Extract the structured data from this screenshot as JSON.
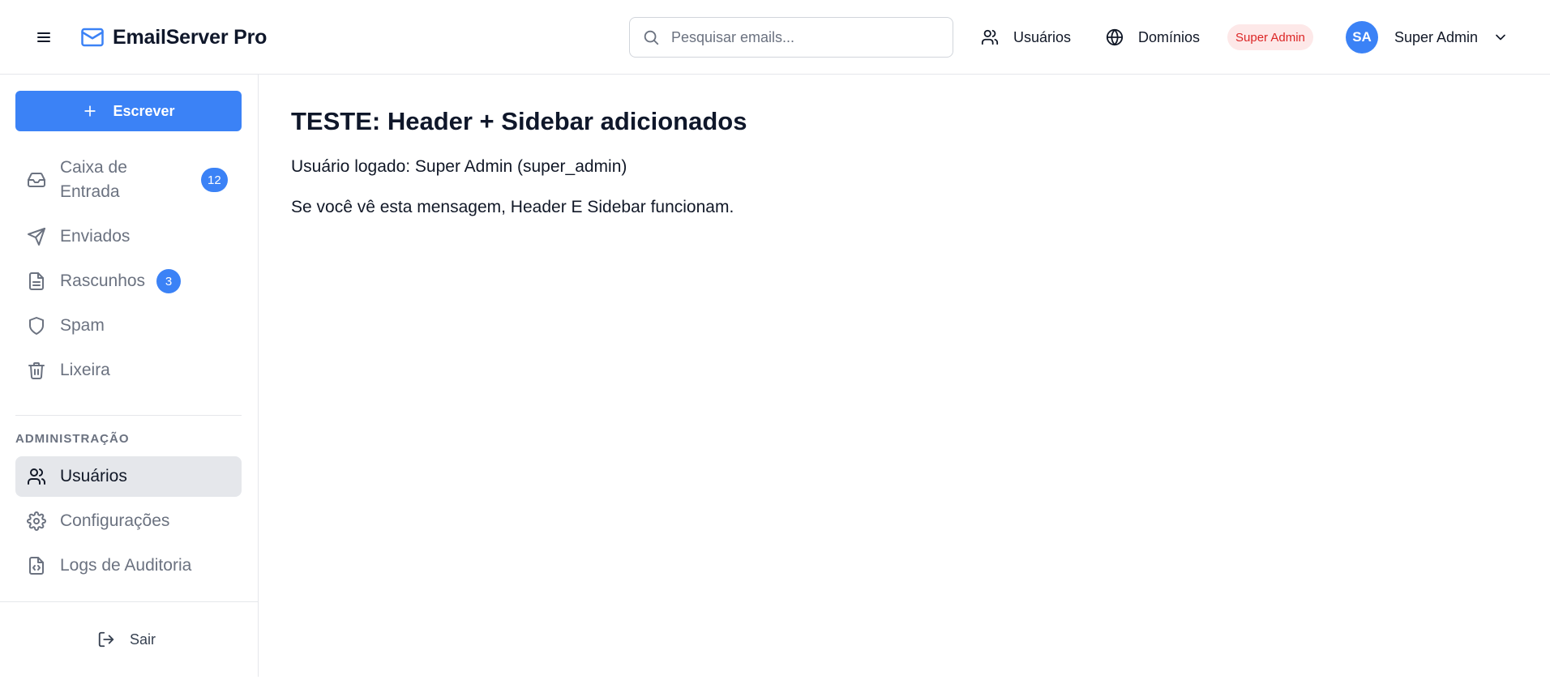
{
  "app": {
    "name": "EmailServer Pro"
  },
  "colors": {
    "accent": "#3b82f6",
    "danger": "#dc2626",
    "danger_bg": "#fde8e8",
    "muted": "#6b7280",
    "active_bg": "#e5e7eb"
  },
  "header": {
    "menu_icon": "hamburger-menu-icon",
    "brand_icon": "mail-icon",
    "search": {
      "placeholder": "Pesquisar emails...",
      "value": "",
      "icon": "search-icon"
    },
    "nav": [
      {
        "label": "Usuários",
        "icon": "users-icon"
      },
      {
        "label": "Domínios",
        "icon": "globe-icon"
      }
    ],
    "role_badge": "Super Admin",
    "user": {
      "initials": "SA",
      "name": "Super Admin",
      "chevron_icon": "chevron-down-icon"
    }
  },
  "sidebar": {
    "compose_label": "Escrever",
    "compose_icon": "plus-icon",
    "folders": [
      {
        "label": "Caixa de Entrada",
        "icon": "inbox-icon",
        "count": "12"
      },
      {
        "label": "Enviados",
        "icon": "send-icon"
      },
      {
        "label": "Rascunhos",
        "icon": "file-text-icon",
        "count": "3"
      },
      {
        "label": "Spam",
        "icon": "shield-icon"
      },
      {
        "label": "Lixeira",
        "icon": "trash-icon"
      }
    ],
    "admin_title": "ADMINISTRAÇÃO",
    "admin_items": [
      {
        "label": "Usuários",
        "icon": "users-icon",
        "active": true
      },
      {
        "label": "Configurações",
        "icon": "settings-icon"
      },
      {
        "label": "Logs de Auditoria",
        "icon": "file-code-icon"
      }
    ],
    "logout_label": "Sair",
    "logout_icon": "log-out-icon"
  },
  "main": {
    "title": "TESTE: Header + Sidebar adicionados",
    "line1": "Usuário logado: Super Admin (super_admin)",
    "line2": "Se você vê esta mensagem, Header E Sidebar funcionam."
  }
}
